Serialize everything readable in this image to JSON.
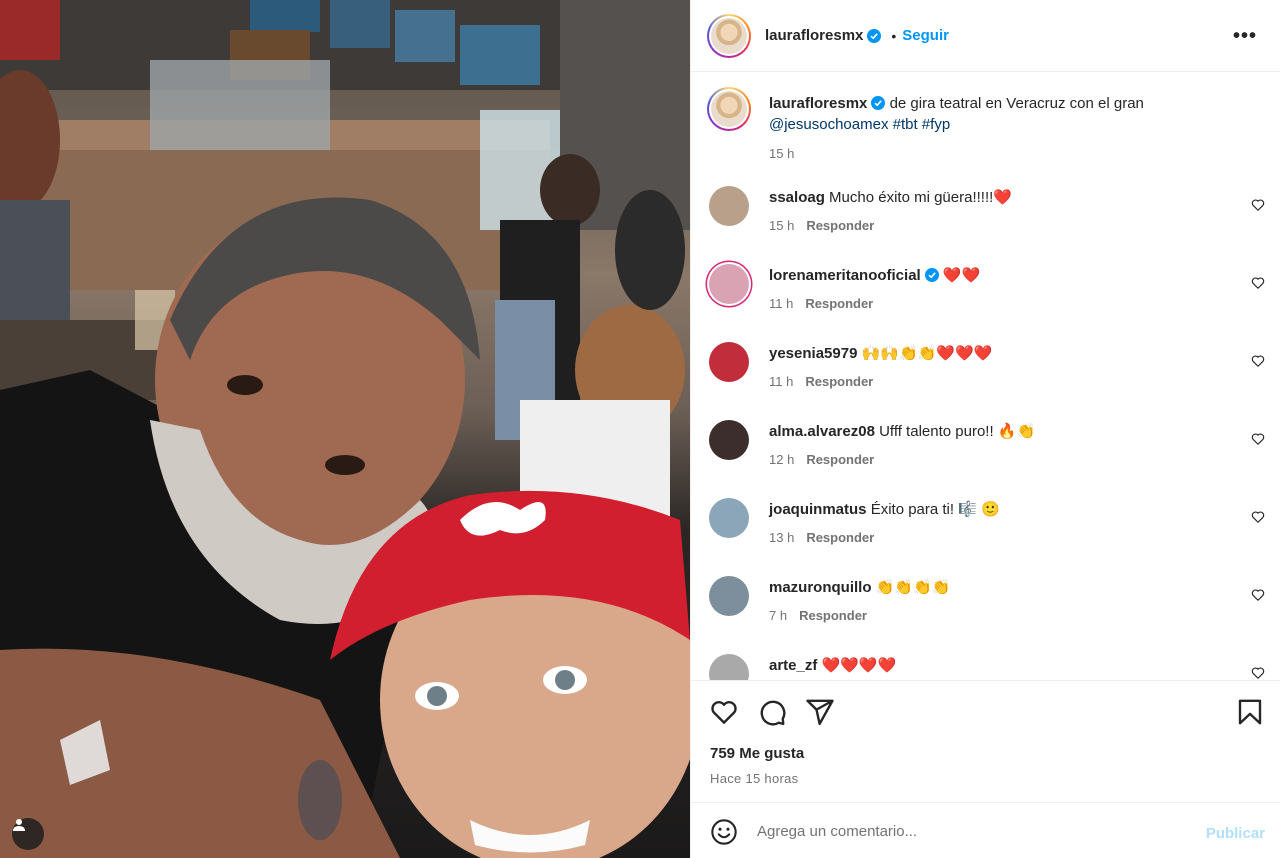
{
  "post": {
    "author": "laurafloresmx",
    "verified": true,
    "follow_label": "Seguir",
    "dot": "•",
    "more_label": "•••",
    "caption_user": "laurafloresmx",
    "caption_text": "de gira teatral en Veracruz con el gran",
    "caption_mention": "@jesusochoamex",
    "caption_tags": "#tbt #fyp",
    "caption_time": "15 h"
  },
  "reply_label": "Responder",
  "comments": [
    {
      "user": "ssaloag",
      "verified": false,
      "text": "Mucho éxito mi güera!!!!!❤️",
      "time": "15 h",
      "avatar_color": "#b9a08a"
    },
    {
      "user": "lorenameritanooficial",
      "verified": true,
      "text": "❤️❤️",
      "time": "11 h",
      "avatar_color": "#d9a3b4"
    },
    {
      "user": "yesenia5979",
      "verified": false,
      "text": "🙌🙌👏👏❤️❤️❤️",
      "time": "11 h",
      "avatar_color": "#c22d3c"
    },
    {
      "user": "alma.alvarez08",
      "verified": false,
      "text": "Ufff talento puro!! 🔥👏",
      "time": "12 h",
      "avatar_color": "#3b2e2c"
    },
    {
      "user": "joaquinmatus",
      "verified": false,
      "text": "Éxito para ti! 🎼 🙂",
      "time": "13 h",
      "avatar_color": "#8aa6b8"
    },
    {
      "user": "mazuronquillo",
      "verified": false,
      "text": "👏👏👏👏",
      "time": "7 h",
      "avatar_color": "#7d8f9c"
    },
    {
      "user": "arte_zf",
      "verified": false,
      "text": "❤️❤️❤️❤️",
      "time": "",
      "avatar_color": "#a9a9a9"
    }
  ],
  "likes_text": "759 Me gusta",
  "posted_ago": "Hace 15 horas",
  "composer": {
    "placeholder": "Agrega un comentario...",
    "publish_label": "Publicar"
  },
  "colors": {
    "link": "#00376b",
    "follow": "#0095f6",
    "publish_disabled": "#b2dffc",
    "muted": "#737373"
  },
  "icons": [
    "verified-badge-icon",
    "more-options-icon",
    "heart-icon",
    "comment-icon",
    "share-icon",
    "bookmark-icon",
    "emoji-icon",
    "user-tag-icon"
  ]
}
